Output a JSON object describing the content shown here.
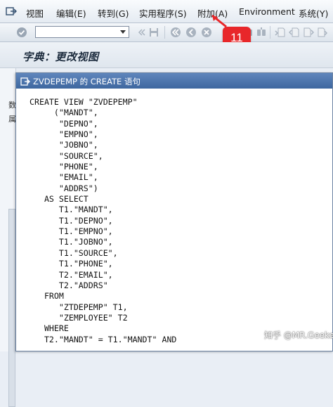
{
  "menubar": {
    "items": [
      "视图",
      "编辑(E)",
      "转到(G)",
      "实用程序(S)",
      "附加(A)",
      "Environment",
      "系统(Y)"
    ]
  },
  "toolbar": {
    "command_field": {
      "value": "",
      "placeholder": ""
    },
    "icons": [
      "check-icon",
      "back-double-icon",
      "save-icon",
      "back-icon",
      "exit-icon",
      "cancel-icon",
      "print-icon",
      "find-icon",
      "find-next-icon",
      "first-page-icon",
      "prev-page-icon",
      "next-page-icon",
      "last-page-icon"
    ]
  },
  "badge": {
    "label": "11"
  },
  "page": {
    "title": "字典：更改视图"
  },
  "background": {
    "fragments": [
      "数",
      "属"
    ]
  },
  "dialog": {
    "title": "ZVDEPEMP 的 CREATE 语句",
    "code_lines": [
      "CREATE VIEW \"ZVDEPEMP\"",
      "     (\"MANDT\",",
      "      \"DEPNO\",",
      "      \"EMPNO\",",
      "      \"JOBNO\",",
      "      \"SOURCE\",",
      "      \"PHONE\",",
      "      \"EMAIL\",",
      "      \"ADDRS\")",
      "   AS SELECT",
      "      T1.\"MANDT\",",
      "      T1.\"DEPNO\",",
      "      T1.\"EMPNO\",",
      "      T1.\"JOBNO\",",
      "      T1.\"SOURCE\",",
      "      T1.\"PHONE\",",
      "      T2.\"EMAIL\",",
      "      T2.\"ADDRS\"",
      "   FROM",
      "      \"ZTDEPEMP\" T1,",
      "      \"ZEMPLOYEE\" T2",
      "   WHERE",
      "   T2.\"MANDT\" = T1.\"MANDT\" AND"
    ]
  },
  "watermark": "知乎 @MR.Geekery",
  "colors": {
    "dialog_titlebar": "#4a72aa",
    "badge": "#e8272a",
    "code_text": "#111111"
  }
}
